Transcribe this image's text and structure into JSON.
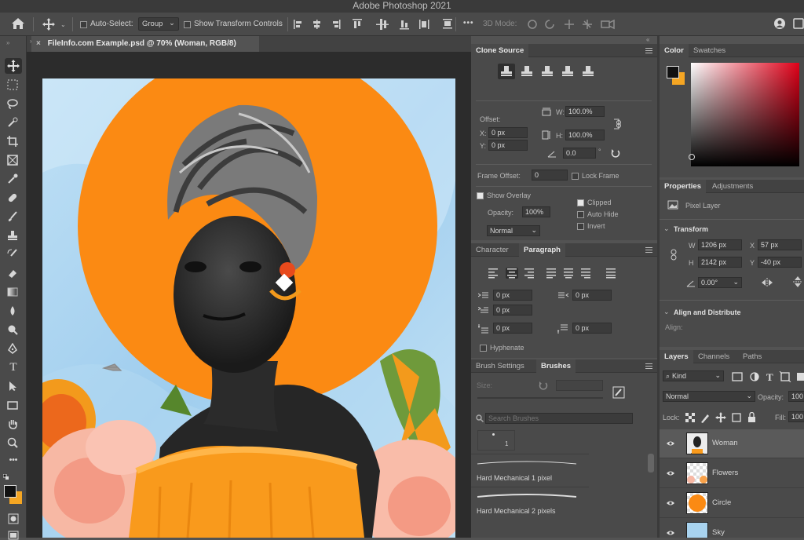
{
  "window": {
    "title": "Adobe Photoshop 2021"
  },
  "options_bar": {
    "auto_select_label": "Auto-Select:",
    "auto_select_value": "Group",
    "show_transform_label": "Show Transform Controls",
    "mode_3d_label": "3D Mode:",
    "more_label": "•••"
  },
  "document": {
    "tab_title": "FileInfo.com Example.psd @ 70% (Woman, RGB/8)",
    "close_glyph": "×"
  },
  "clone_source": {
    "tab": "Clone Source",
    "offset_label": "Offset:",
    "x_label": "X:",
    "x_value": "0 px",
    "y_label": "Y:",
    "y_value": "0 px",
    "w_label": "W:",
    "w_value": "100.0%",
    "h_label": "H:",
    "h_value": "100.0%",
    "angle_value": "0.0",
    "frame_offset_label": "Frame Offset:",
    "frame_offset_value": "0",
    "lock_frame_label": "Lock Frame",
    "show_overlay_label": "Show Overlay",
    "opacity_label": "Opacity:",
    "opacity_value": "100%",
    "blend_value": "Normal",
    "clipped_label": "Clipped",
    "auto_hide_label": "Auto Hide",
    "invert_label": "Invert"
  },
  "char_para": {
    "tabs": [
      "Character",
      "Paragraph"
    ],
    "indent_left_value": "0 px",
    "indent_right_value": "0 px",
    "first_line_value": "0 px",
    "space_before_value": "0 px",
    "space_after_value": "0 px",
    "hyphenate_label": "Hyphenate"
  },
  "brushes": {
    "tabs": [
      "Brush Settings",
      "Brushes"
    ],
    "size_label": "Size:",
    "search_placeholder": "Search Brushes",
    "preset_number": "1",
    "items": [
      "Hard Mechanical 1 pixel",
      "Hard Mechanical 2 pixels"
    ]
  },
  "color": {
    "tabs": [
      "Color",
      "Swatches"
    ],
    "fg": "#111111",
    "bg": "#f5a623"
  },
  "properties": {
    "tabs": [
      "Properties",
      "Adjustments"
    ],
    "pixel_layer_label": "Pixel Layer",
    "transform_label": "Transform",
    "w_label": "W",
    "w_value": "1206 px",
    "h_label": "H",
    "h_value": "2142 px",
    "x_label": "X",
    "x_value": "57 px",
    "y_label": "Y",
    "y_value": "-40 px",
    "angle_value": "0.00°",
    "align_label": "Align and Distribute",
    "align_sub": "Align:"
  },
  "layers": {
    "tabs": [
      "Layers",
      "Channels",
      "Paths"
    ],
    "kind_value": "Kind",
    "blend_value": "Normal",
    "opacity_label": "Opacity:",
    "opacity_value": "100",
    "lock_label": "Lock:",
    "fill_label": "Fill:",
    "fill_value": "100",
    "items": [
      {
        "name": "Woman",
        "selected": true
      },
      {
        "name": "Flowers",
        "selected": false
      },
      {
        "name": "Circle",
        "selected": false
      },
      {
        "name": "Sky",
        "selected": false
      }
    ]
  },
  "colors": {
    "orange": "#fb8a13",
    "sky": "#a8d3ef",
    "panel": "#4a4a4a"
  }
}
